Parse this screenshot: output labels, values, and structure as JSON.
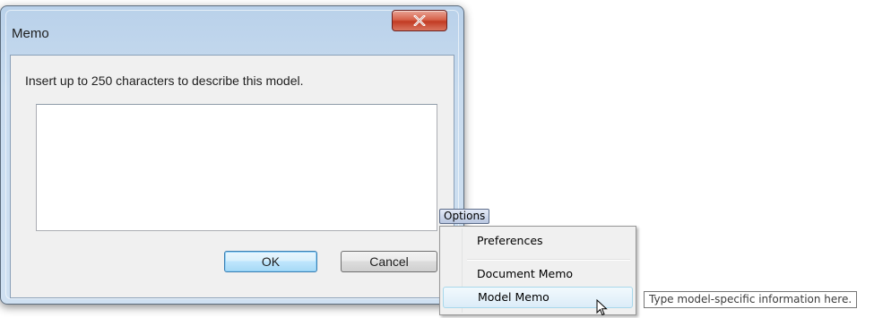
{
  "dialog": {
    "title": "Memo",
    "instruction": "Insert up to 250 characters to describe this model.",
    "memo_value": "",
    "ok_label": "OK",
    "cancel_label": "Cancel"
  },
  "options_menu": {
    "tab_label": "Options",
    "items": [
      {
        "label": "Preferences"
      },
      {
        "label": "Document Memo"
      },
      {
        "label": "Model Memo",
        "highlighted": true
      }
    ],
    "tooltip": "Type model-specific information here."
  },
  "colors": {
    "close_button": "#c23b23",
    "title_bar": "#b9d1ea",
    "menu_highlight": "#dcecf8"
  },
  "icons": {
    "close": "close-icon",
    "cursor": "mouse-cursor-icon"
  }
}
